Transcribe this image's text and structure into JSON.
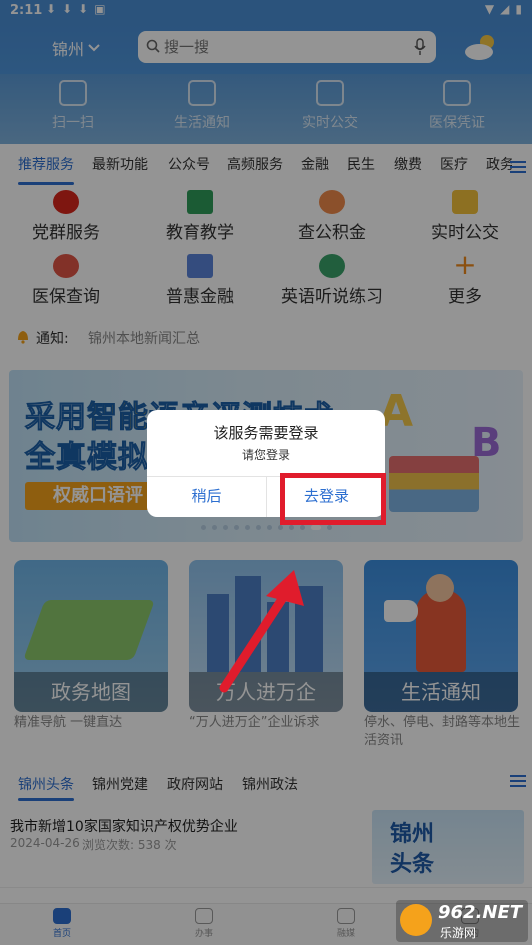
{
  "status_bar": {
    "time": "2:11"
  },
  "header": {
    "city": "锦州",
    "search_placeholder": "搜一搜"
  },
  "quick_bar": {
    "items": [
      "扫一扫",
      "生活通知",
      "实时公交",
      "医保凭证"
    ]
  },
  "category_tabs": {
    "items": [
      "推荐服务",
      "最新功能",
      "公众号",
      "高频服务",
      "金融",
      "民生",
      "缴费",
      "医疗",
      "政务"
    ],
    "active": "推荐服务"
  },
  "services": {
    "items": [
      "党群服务",
      "教育教学",
      "查公积金",
      "实时公交",
      "医保查询",
      "普惠金融",
      "英语听说练习",
      "更多"
    ]
  },
  "notice": {
    "label": "通知:",
    "text": "锦州本地新闻汇总"
  },
  "banner": {
    "line1_pre": "采用",
    "line1_hl": "智能",
    "line1_post": "语音评测技术",
    "line2": "全真模拟中考英语听说",
    "badge": "权威口语评"
  },
  "cards": [
    {
      "label": "政务地图",
      "sub": "精准导航 一键直达"
    },
    {
      "label": "万人进万企",
      "sub": "“万人进万企”企业诉求"
    },
    {
      "label": "生活通知",
      "sub": "停水、停电、封路等本地生活资讯"
    }
  ],
  "news_tabs": {
    "items": [
      "锦州头条",
      "锦州党建",
      "政府网站",
      "锦州政法"
    ],
    "active": "锦州头条"
  },
  "news": [
    {
      "title": "我市新增10家国家知识产权优势企业",
      "date": "2024-04-26",
      "views": "浏览次数: 538 次",
      "thumb_line1": "锦州",
      "thumb_line2": "头条"
    }
  ],
  "bottom_nav": {
    "items": [
      "首页",
      "办事",
      "融媒",
      "我的"
    ],
    "active": "首页"
  },
  "dialog": {
    "title": "该服务需要登录",
    "message": "请您登录",
    "cancel": "稍后",
    "confirm": "去登录"
  },
  "watermark": {
    "brand": "962.NET",
    "sub": "乐游网"
  },
  "colors": {
    "accent": "#2d6fd0",
    "header": "#4a8fd6",
    "highlight": "#e01c2c"
  }
}
